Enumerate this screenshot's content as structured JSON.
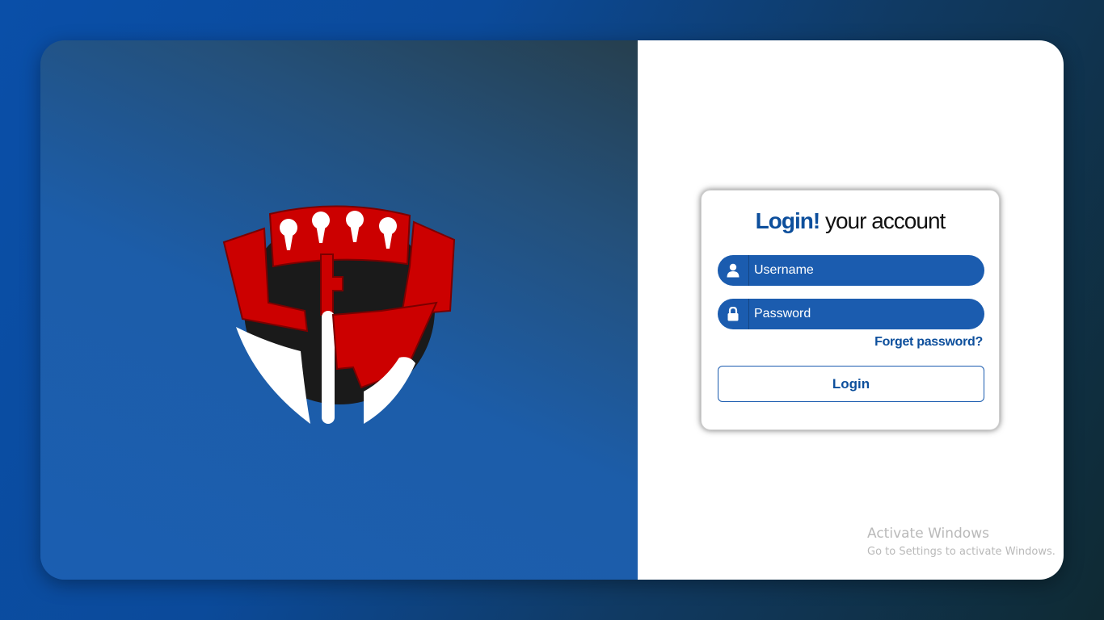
{
  "brand": {
    "logo_icon": "shield-keyhole-logo"
  },
  "login": {
    "title_strong": "Login!",
    "title_rest": " your account",
    "username_placeholder": "Username",
    "password_placeholder": "Password",
    "forget_label": "Forget password?",
    "login_label": "Login",
    "username_icon": "user-icon",
    "password_icon": "lock-icon"
  },
  "watermark": {
    "line1": "Activate Windows",
    "line2": "Go to Settings to activate Windows."
  },
  "colors": {
    "accent": "#0d4f9c",
    "field_bg": "#1b5caf",
    "logo_red": "#cc0000"
  }
}
